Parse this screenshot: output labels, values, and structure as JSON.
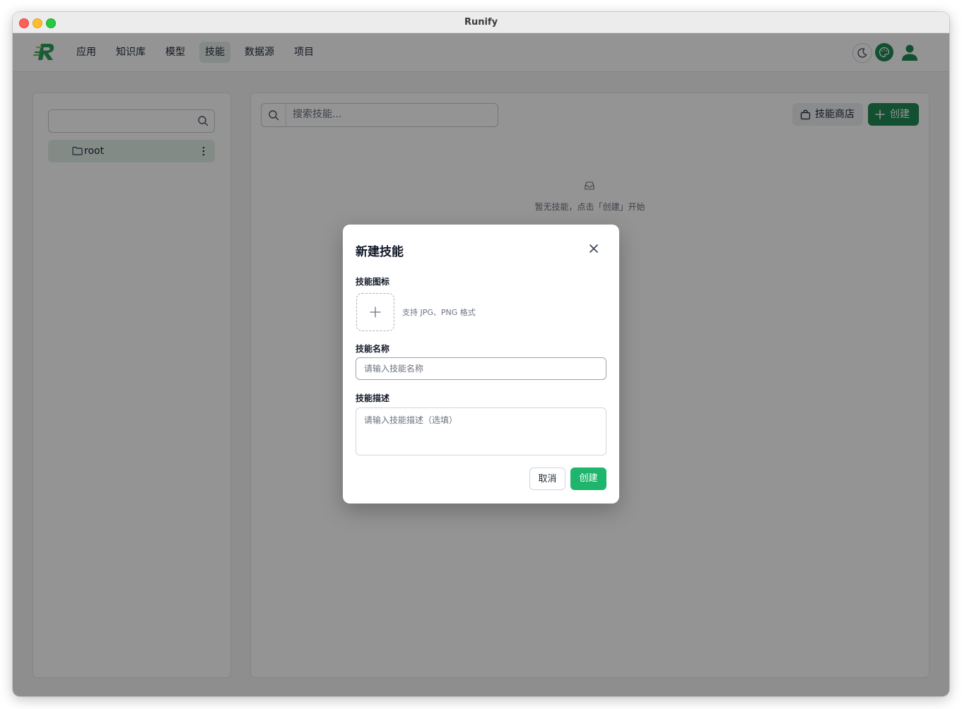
{
  "window": {
    "title": "Runify"
  },
  "nav": {
    "items": [
      {
        "label": "应用"
      },
      {
        "label": "知识库"
      },
      {
        "label": "模型"
      },
      {
        "label": "技能",
        "active": true
      },
      {
        "label": "数据源"
      },
      {
        "label": "项目"
      }
    ],
    "icons": [
      "moon-icon",
      "palette-icon",
      "user-icon"
    ]
  },
  "sidebar": {
    "search_placeholder": "",
    "tree": [
      {
        "label": "root"
      }
    ]
  },
  "main": {
    "search_placeholder": "搜索技能...",
    "store_label": "技能商店",
    "create_label": "创建",
    "empty_text": "暂无技能，点击「创建」开始"
  },
  "modal": {
    "title": "新建技能",
    "icon_label": "技能图标",
    "upload_hint": "支持 JPG、PNG 格式",
    "name_label": "技能名称",
    "name_placeholder": "请输入技能名称",
    "desc_label": "技能描述",
    "desc_placeholder": "请输入技能描述（选填）",
    "cancel_label": "取消",
    "confirm_label": "创建"
  },
  "colors": {
    "primary": "#1f8a55",
    "confirm": "#1fb56c",
    "active_bg": "#e3efe8"
  }
}
